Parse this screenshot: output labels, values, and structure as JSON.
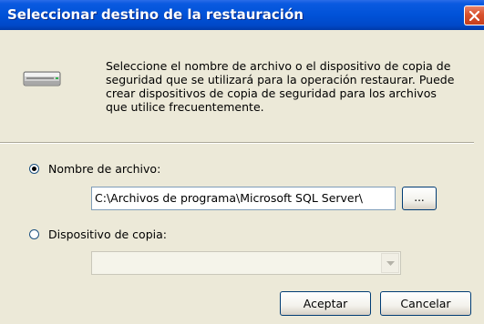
{
  "window": {
    "title": "Seleccionar destino de la restauración"
  },
  "header": {
    "icon": "backup-device-icon",
    "description": "Seleccione el nombre de archivo o el dispositivo de copia de seguridad que se utilizará para la operación restaurar. Puede crear dispositivos de copia de seguridad para los archivos que utilice frecuentemente."
  },
  "options": {
    "file_name": {
      "label": "Nombre de archivo:",
      "selected": true,
      "value": "C:\\Archivos de programa\\Microsoft SQL Server\\",
      "browse_label": "..."
    },
    "backup_device": {
      "label": "Dispositivo de copia:",
      "selected": false,
      "value": "",
      "enabled": false
    }
  },
  "buttons": {
    "ok_label": "Aceptar",
    "cancel_label": "Cancelar"
  },
  "colors": {
    "titlebar": "#0052D8",
    "dialog_background": "#ECE9D8",
    "close_button": "#D9512C"
  }
}
